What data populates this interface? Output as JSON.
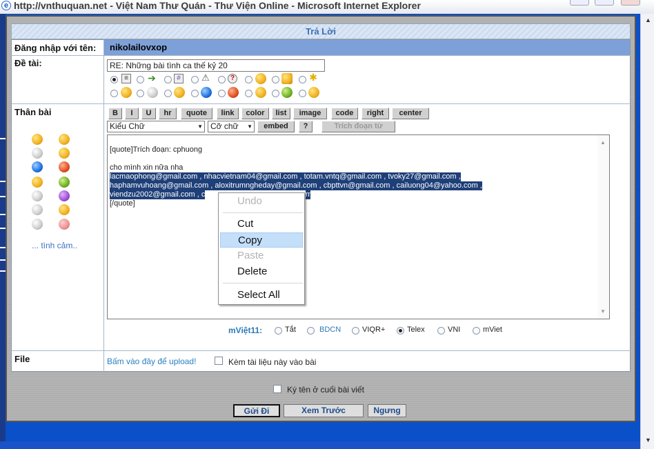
{
  "window": {
    "title": "http://vnthuquan.net - Việt Nam Thư Quán - Thư Viện Online - Microsoft Internet Explorer"
  },
  "form": {
    "header": "Trả Lời",
    "login_label": "Đăng nhập với tên:",
    "username": "nikolailovxop",
    "subject_label": "Đề tài:",
    "subject_value": "RE: Những bài tình ca thế kỷ 20",
    "body_label": "Thân bài",
    "emoticons_link": "... tình cảm..",
    "file_label": "File",
    "upload_link": "Bấm vào đây để upload!",
    "attach_label": "Kèm tài liệu này vào bài",
    "signature_label": "Ký tên ở cuối bài viết"
  },
  "toolbar": {
    "buttons": [
      "B",
      "I",
      "U",
      "hr",
      "quote",
      "link",
      "color",
      "list",
      "image",
      "code",
      "right",
      "center"
    ],
    "font_select": "Kiểu Chữ",
    "size_select": "Cỡ chữ",
    "embed": "embed",
    "help": "?",
    "quote_excerpt": "Trích đoạn từ"
  },
  "message": {
    "lines": [
      "[quote]Trích đoạn:  cphuong",
      "cho mình xin nữa nha",
      "lacmaophong@gmail.com , nhacvietnam04@gmail.com , totam.vntq@gmail.com , tvoky27@gmail.com ,",
      "haphamvuhoang@gmail.com , aloxitrumngheday@gmail.com , cbpttvn@gmail.com , cailuong04@yahoo.com ,",
      "viendzu2002@gmail.com , c",
      "m",
      "[/quote]"
    ]
  },
  "input_method": {
    "label": "mViệt11",
    "options": [
      "Tắt",
      "BDCN",
      "VIQR+",
      "Telex",
      "VNI",
      "mViet"
    ],
    "selected": "Telex"
  },
  "buttons": {
    "submit": "Gửi Đi",
    "preview": "Xem Trước",
    "stop": "Ngưng"
  },
  "context_menu": {
    "undo": "Undo",
    "cut": "Cut",
    "copy": "Copy",
    "paste": "Paste",
    "delete": "Delete",
    "select_all": "Select All"
  },
  "colors": {
    "header_text": "#3b6fb5",
    "username_bg": "#7ea0d8",
    "selection_bg": "#1e3f78",
    "menu_highlight": "#c4dffa"
  }
}
